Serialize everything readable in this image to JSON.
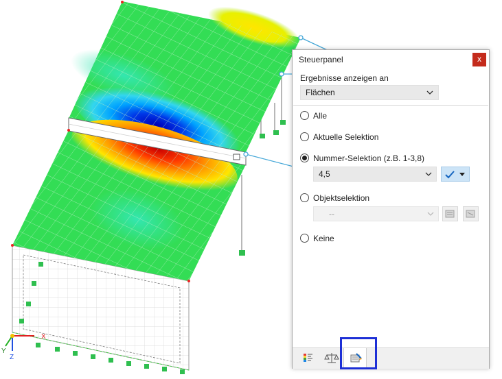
{
  "panel": {
    "title": "Steuerpanel",
    "close_label": "x",
    "display_label": "Ergebnisse anzeigen an",
    "display_value": "Flächen",
    "options": {
      "all": "Alle",
      "current": "Aktuelle Selektion",
      "number": "Nummer-Selektion (z.B. 1-3,8)",
      "object": "Objektselektion",
      "none": "Keine"
    },
    "selected_option": "number",
    "number_value": "4,5",
    "object_value": "--"
  },
  "axes": {
    "x": "X",
    "y": "Y",
    "z": "Z"
  },
  "footer": {
    "tabs": [
      "color-scale-icon",
      "balance-icon",
      "display-filter-icon"
    ],
    "active_tab": "display-filter-icon"
  },
  "colors": {
    "accent": "#1d2fd6",
    "close": "#c42b1c",
    "surface_green": "#33dd55"
  }
}
